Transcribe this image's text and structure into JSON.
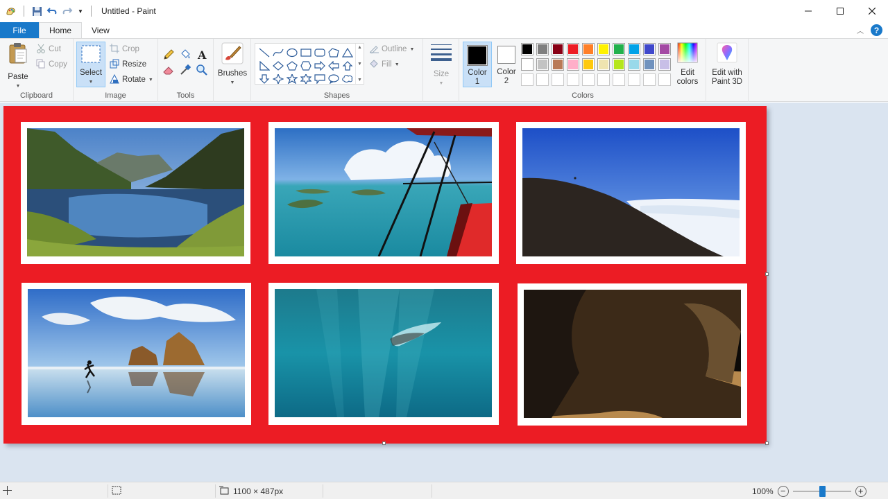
{
  "app": {
    "title": "Untitled - Paint"
  },
  "tabs": {
    "file": "File",
    "home": "Home",
    "view": "View"
  },
  "clipboard": {
    "label": "Clipboard",
    "paste": "Paste",
    "cut": "Cut",
    "copy": "Copy"
  },
  "image": {
    "label": "Image",
    "select": "Select",
    "crop": "Crop",
    "resize": "Resize",
    "rotate": "Rotate"
  },
  "tools": {
    "label": "Tools"
  },
  "brushes": {
    "label": "Brushes"
  },
  "shapes": {
    "label": "Shapes",
    "outline": "Outline",
    "fill": "Fill"
  },
  "size": {
    "label": "Size"
  },
  "colors": {
    "label": "Colors",
    "color1": "Color 1",
    "color2": "Color 2",
    "color1_value": "#000000",
    "color2_value": "#ffffff",
    "edit_colors": "Edit colors",
    "palette_row1": [
      "#000000",
      "#7f7f7f",
      "#880015",
      "#ed1c24",
      "#ff7f27",
      "#fff200",
      "#22b14c",
      "#00a2e8",
      "#3f48cc",
      "#a349a4"
    ],
    "palette_row2": [
      "#ffffff",
      "#c3c3c3",
      "#b97a57",
      "#ffaec9",
      "#ffc90e",
      "#efe4b0",
      "#b5e61d",
      "#99d9ea",
      "#7092be",
      "#c8bfe7"
    ]
  },
  "paint3d": {
    "label": "Edit with Paint 3D"
  },
  "canvas": {
    "background": "#ec1c24",
    "photos": [
      {
        "name": "mountain-lake-photo"
      },
      {
        "name": "aerial-islands-photo"
      },
      {
        "name": "hillside-clouds-photo"
      },
      {
        "name": "beach-runner-photo"
      },
      {
        "name": "underwater-swimmer-photo"
      },
      {
        "name": "sea-cave-photo"
      }
    ]
  },
  "status": {
    "dimensions": "1100 × 487px",
    "zoom": "100%",
    "zoom_level": 0.5
  }
}
